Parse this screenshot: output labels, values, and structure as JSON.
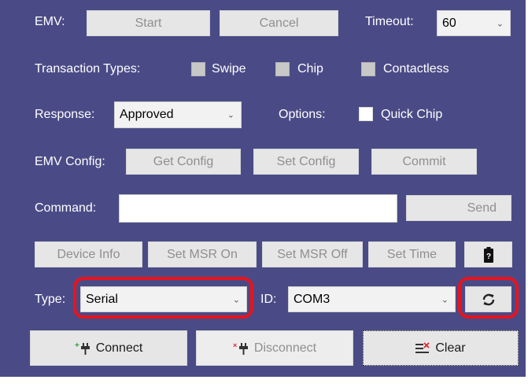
{
  "emv": {
    "label": "EMV:",
    "start_label": "Start",
    "cancel_label": "Cancel",
    "timeout_label": "Timeout:",
    "timeout_value": "60"
  },
  "transaction": {
    "label": "Transaction Types:",
    "swipe_label": "Swipe",
    "chip_label": "Chip",
    "contactless_label": "Contactless"
  },
  "response": {
    "label": "Response:",
    "value": "Approved",
    "options_label": "Options:",
    "quick_chip_label": "Quick Chip"
  },
  "emv_config": {
    "label": "EMV Config:",
    "get_config_label": "Get Config",
    "set_config_label": "Set Config",
    "commit_label": "Commit"
  },
  "command": {
    "label": "Command:",
    "value": "",
    "send_label": "Send"
  },
  "device": {
    "device_info_label": "Device Info",
    "set_msr_on_label": "Set MSR On",
    "set_msr_off_label": "Set MSR Off",
    "set_time_label": "Set Time",
    "battery_icon": "battery-icon"
  },
  "connection": {
    "type_label": "Type:",
    "type_value": "Serial",
    "id_label": "ID:",
    "id_value": "COM3",
    "refresh_icon": "refresh-icon"
  },
  "actions": {
    "connect_label": "Connect",
    "disconnect_label": "Disconnect",
    "clear_label": "Clear"
  },
  "colors": {
    "panel_background": "#4a4b86",
    "highlight": "#e8131d",
    "connect_plug_accent": "#2e9e3e",
    "disconnect_plug_accent": "#d9262f"
  }
}
